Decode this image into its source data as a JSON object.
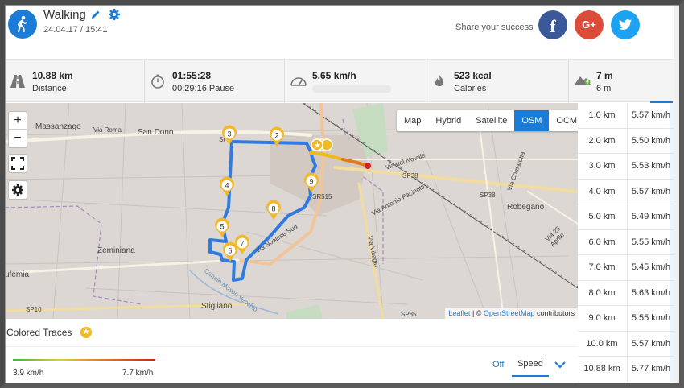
{
  "header": {
    "title": "Walking",
    "datetime": "24.04.17 / 15:41",
    "share_text": "Share your success",
    "facebook_label": "f",
    "google_label": "G+"
  },
  "stats": [
    {
      "icon": "road-icon",
      "value": "10.88 km",
      "label": "Distance"
    },
    {
      "icon": "stopwatch-icon",
      "value": "01:55:28",
      "label": "00:29:16 Pause"
    },
    {
      "icon": "speedometer-icon",
      "value": "5.65 km/h",
      "label": ""
    },
    {
      "icon": "flame-icon",
      "value": "523 kcal",
      "label": "Calories"
    },
    {
      "icon": "elevation-icon",
      "value": "7 m",
      "label": "6 m"
    }
  ],
  "map": {
    "zoom_in": "+",
    "zoom_out": "−",
    "layers": [
      "Map",
      "Hybrid",
      "Satellite",
      "OSM",
      "OCM"
    ],
    "active_layer": "OSM",
    "attribution_leaflet": "Leaflet",
    "attribution_sep": " | © ",
    "attribution_osm": "OpenStreetMap",
    "attribution_tail": " contributors",
    "places": [
      "Massanzago",
      "San Dono",
      "Zeminiana",
      "Robegano",
      "Stigliano",
      "ufemia"
    ],
    "roads": [
      "Via Roma",
      "Via Noalese Sud",
      "SR515",
      "SP38",
      "SP38",
      "Via del Novale",
      "Via Antonio Pacinotti",
      "Via Villagio",
      "SP10",
      "SP35",
      "Via Comarotta",
      "Via 25 Aprile",
      "Canale Muson Vecchio",
      "Sr"
    ],
    "markers": [
      "2",
      "3",
      "4",
      "5",
      "6",
      "7",
      "8",
      "9"
    ]
  },
  "splits": [
    {
      "km": "1.0 km",
      "speed": "5.57 km/h"
    },
    {
      "km": "2.0 km",
      "speed": "5.50 km/h"
    },
    {
      "km": "3.0 km",
      "speed": "5.53 km/h"
    },
    {
      "km": "4.0 km",
      "speed": "5.57 km/h"
    },
    {
      "km": "5.0 km",
      "speed": "5.49 km/h"
    },
    {
      "km": "6.0 km",
      "speed": "5.55 km/h"
    },
    {
      "km": "7.0 km",
      "speed": "5.45 km/h"
    },
    {
      "km": "8.0 km",
      "speed": "5.63 km/h"
    },
    {
      "km": "9.0 km",
      "speed": "5.55 km/h"
    },
    {
      "km": "10.0 km",
      "speed": "5.57 km/h"
    },
    {
      "km": "10.88 km",
      "speed": "5.77 km/h"
    }
  ],
  "traces": {
    "title": "Colored Traces",
    "min": "3.9 km/h",
    "max": "7.7 km/h",
    "off_label": "Off",
    "mode": "Speed"
  },
  "colors": {
    "accent": "#1a7cd6",
    "facebook": "#3b5998",
    "google": "#dd4b39",
    "twitter": "#1da1f2",
    "route": "#2f7be0",
    "marker": "#f2b826"
  }
}
